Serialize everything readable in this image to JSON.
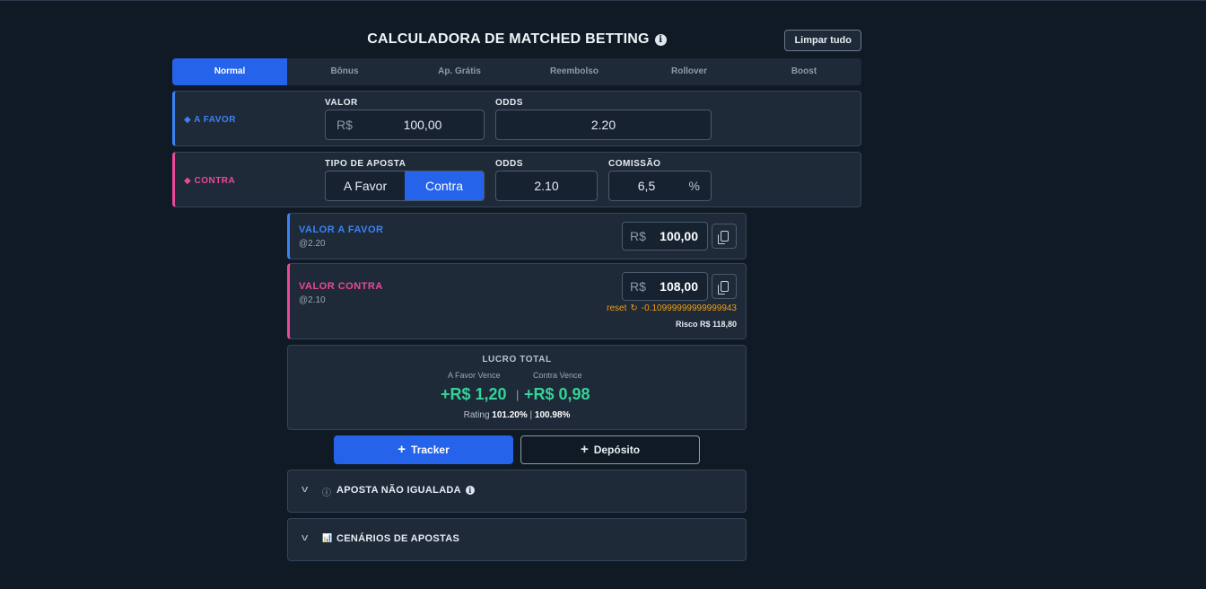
{
  "header": {
    "title": "CALCULADORA DE MATCHED BETTING",
    "clear_label": "Limpar tudo",
    "info_glyph": "i"
  },
  "tabs": [
    {
      "label": "Normal",
      "active": true
    },
    {
      "label": "Bônus"
    },
    {
      "label": "Ap. Grátis"
    },
    {
      "label": "Reembolso"
    },
    {
      "label": "Rollover"
    },
    {
      "label": "Boost"
    }
  ],
  "favor": {
    "label": "◆ A FAVOR",
    "valor_label": "VALOR",
    "currency": "R$",
    "valor": "100,00",
    "odds_label": "ODDS",
    "odds": "2.20"
  },
  "contra": {
    "label": "◆ CONTRA",
    "tipo_label": "TIPO DE APOSTA",
    "tipo_options": [
      "A Favor",
      "Contra"
    ],
    "odds_label": "ODDS",
    "odds": "2.10",
    "comissao_label": "COMISSÃO",
    "comissao": "6,5",
    "percent": "%"
  },
  "result_favor": {
    "title": "VALOR A FAVOR",
    "sub": "@2.20",
    "currency": "R$",
    "amount": "100,00"
  },
  "result_contra": {
    "title": "VALOR CONTRA",
    "sub": "@2.10",
    "currency": "R$",
    "amount": "108,00",
    "reset_label": "reset",
    "reset_icon": "↻",
    "diff": "-0.10999999999999943",
    "risk": "Risco R$ 118,80"
  },
  "lucro": {
    "title": "LUCRO TOTAL",
    "favor_label": "A Favor Vence",
    "contra_label": "Contra Vence",
    "favor_value": "+R$ 1,20",
    "contra_value": "+R$ 0,98",
    "separator": "|",
    "rating_label": "Rating",
    "rating_favor": "101.20%",
    "rating_sep": " | ",
    "rating_contra": "100.98%"
  },
  "buttons": {
    "plus": "+",
    "tracker": "Tracker",
    "deposito": "Depósito"
  },
  "accordions": {
    "chevron": "v",
    "nao_igualada": {
      "icon": "ⓘ",
      "label": "APOSTA NÃO IGUALADA"
    },
    "cenarios": {
      "icon": "📊",
      "label": "CENÁRIOS DE APOSTAS"
    }
  },
  "colors": {
    "accent": "#2563eb",
    "favor": "#3b82f6",
    "contra": "#ec4899",
    "profit": "#34d399",
    "warning": "#f59e0b"
  }
}
